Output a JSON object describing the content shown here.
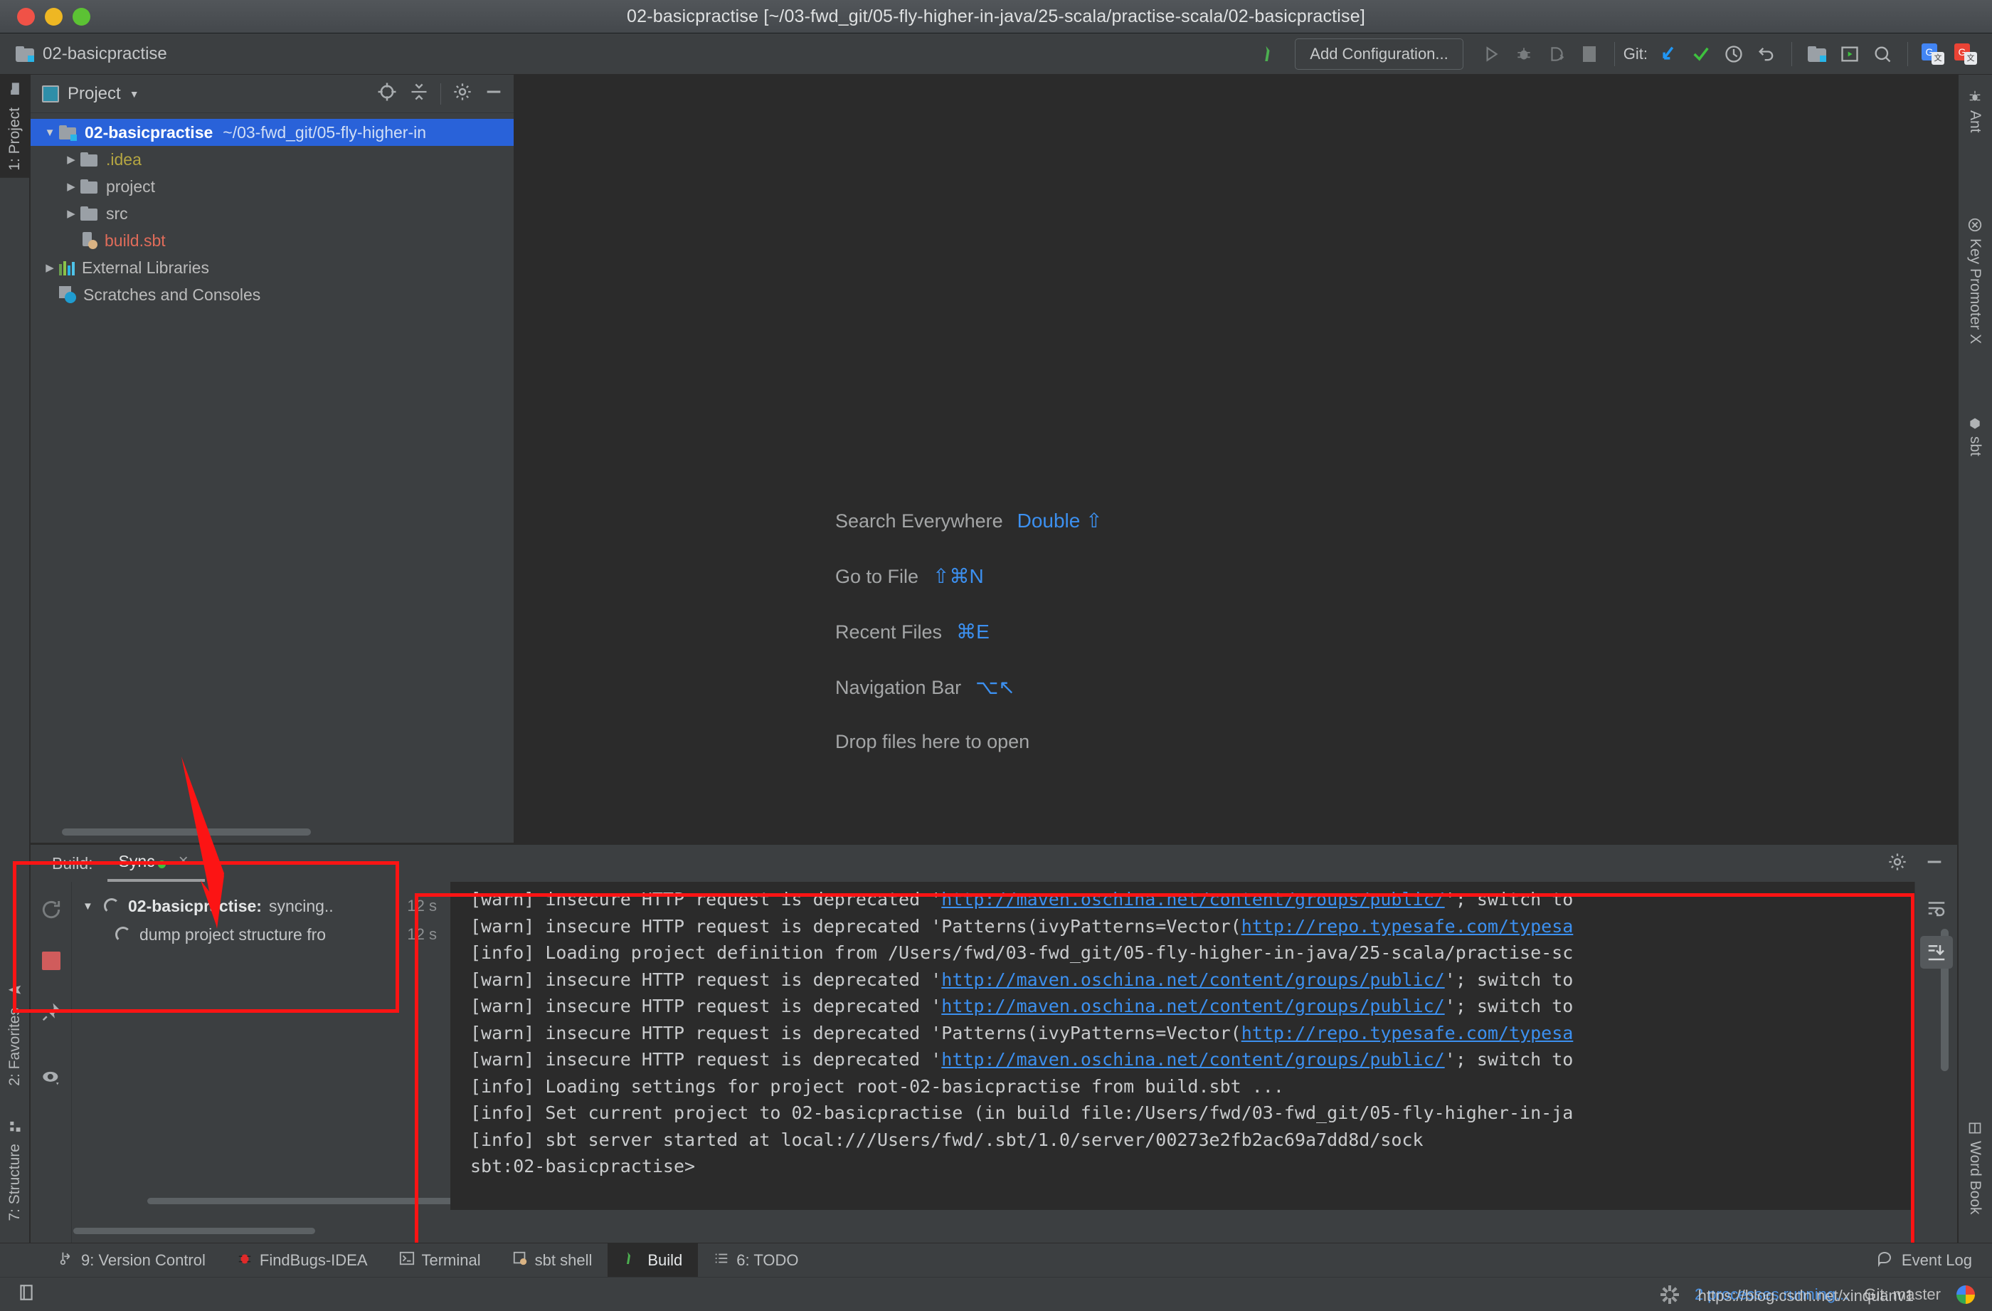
{
  "window": {
    "title": "02-basicpractise [~/03-fwd_git/05-fly-higher-in-java/25-scala/practise-scala/02-basicpractise]",
    "traffic": {
      "close": "close-button",
      "minimize": "minimize-button",
      "zoom": "zoom-button"
    }
  },
  "toolbar": {
    "project_name": "02-basicpractise",
    "add_configuration": "Add Configuration...",
    "git_label": "Git:",
    "icons": [
      "build-hammer-icon",
      "run-icon",
      "debug-icon",
      "coverage-icon",
      "stop-icon",
      "update-project-icon",
      "commit-icon",
      "history-icon",
      "rollback-icon",
      "project-structure-icon",
      "select-target-icon",
      "search-icon",
      "google-translate-icon",
      "translate-icon"
    ]
  },
  "left_strip": {
    "tabs": [
      {
        "label": "1: Project",
        "selected": true
      },
      {
        "label": "2: Favorites",
        "selected": false
      },
      {
        "label": "7: Structure",
        "selected": false
      }
    ]
  },
  "right_strip": {
    "tabs": [
      {
        "label": "Ant"
      },
      {
        "label": "Key Promoter X"
      },
      {
        "label": "sbt"
      },
      {
        "label": "Word Book"
      }
    ]
  },
  "project_panel": {
    "title": "Project",
    "tree": [
      {
        "indent": 0,
        "arrow": "open",
        "icon": "project-folder-icon",
        "name": "02-basicpractise",
        "bold": true,
        "path": "~/03-fwd_git/05-fly-higher-in",
        "selected": true
      },
      {
        "indent": 1,
        "arrow": "closed",
        "icon": "folder-icon",
        "name": ".idea",
        "color": "yellow"
      },
      {
        "indent": 1,
        "arrow": "closed",
        "icon": "folder-icon",
        "name": "project"
      },
      {
        "indent": 1,
        "arrow": "closed",
        "icon": "folder-icon",
        "name": "src"
      },
      {
        "indent": 1,
        "arrow": "none",
        "icon": "sbt-file-icon",
        "name": "build.sbt",
        "color": "red"
      },
      {
        "indent": 0,
        "arrow": "closed",
        "icon": "libraries-icon",
        "name": "External Libraries"
      },
      {
        "indent": 0,
        "arrow": "none",
        "icon": "scratches-icon",
        "name": "Scratches and Consoles"
      }
    ]
  },
  "editor": {
    "tips": [
      {
        "action": "Search Everywhere",
        "shortcut": "Double ⇧"
      },
      {
        "action": "Go to File",
        "shortcut": "⇧⌘N"
      },
      {
        "action": "Recent Files",
        "shortcut": "⌘E"
      },
      {
        "action": "Navigation Bar",
        "shortcut": "⌥↖"
      },
      {
        "action": "Drop files here to open",
        "shortcut": ""
      }
    ]
  },
  "build_panel": {
    "label": "Build:",
    "tab": "Sync",
    "close": "×",
    "side_icons": [
      "rerun-icon",
      "stop-icon",
      "pin-icon",
      "toggle-view-icon"
    ],
    "header_icons": [
      "settings-gear-icon",
      "hide-icon"
    ],
    "console_icons": [
      "soft-wrap-icon",
      "scroll-to-end-icon"
    ],
    "tree": [
      {
        "indent": 0,
        "arrow": "open",
        "bold": "02-basicpractise:",
        "rest": "syncing..",
        "time": "12 s"
      },
      {
        "indent": 1,
        "arrow": "none",
        "bold": "",
        "rest": "dump project structure fro",
        "time": "12 s"
      }
    ],
    "console_lines": [
      [
        {
          "t": "[warn] insecure HTTP request is deprecated '"
        },
        {
          "t": "http://maven.oschina.net/content/groups/public/",
          "link": true
        },
        {
          "t": "'; switch to"
        }
      ],
      [
        {
          "t": "[warn] insecure HTTP request is deprecated 'Patterns(ivyPatterns=Vector("
        },
        {
          "t": "http://repo.typesafe.com/typesa",
          "link": true
        }
      ],
      [
        {
          "t": "[info] Loading project definition from /Users/fwd/03-fwd_git/05-fly-higher-in-java/25-scala/practise-sc"
        }
      ],
      [
        {
          "t": "[warn] insecure HTTP request is deprecated '"
        },
        {
          "t": "http://maven.oschina.net/content/groups/public/",
          "link": true
        },
        {
          "t": "'; switch to"
        }
      ],
      [
        {
          "t": "[warn] insecure HTTP request is deprecated '"
        },
        {
          "t": "http://maven.oschina.net/content/groups/public/",
          "link": true
        },
        {
          "t": "'; switch to"
        }
      ],
      [
        {
          "t": "[warn] insecure HTTP request is deprecated 'Patterns(ivyPatterns=Vector("
        },
        {
          "t": "http://repo.typesafe.com/typesa",
          "link": true
        }
      ],
      [
        {
          "t": "[warn] insecure HTTP request is deprecated '"
        },
        {
          "t": "http://maven.oschina.net/content/groups/public/",
          "link": true
        },
        {
          "t": "'; switch to"
        }
      ],
      [
        {
          "t": "[info] Loading settings for project root-02-basicpractise from build.sbt ..."
        }
      ],
      [
        {
          "t": "[info] Set current project to 02-basicpractise (in build file:/Users/fwd/03-fwd_git/05-fly-higher-in-ja"
        }
      ],
      [
        {
          "t": "[info] sbt server started at local:///Users/fwd/.sbt/1.0/server/00273e2fb2ac69a7dd8d/sock"
        }
      ],
      [
        {
          "t": "sbt:02-basicpractise>"
        }
      ]
    ]
  },
  "bottom_tabs": [
    {
      "label": "9: Version Control",
      "icon": "version-control-icon",
      "selected": false,
      "mnemonic": "9"
    },
    {
      "label": "FindBugs-IDEA",
      "icon": "findbugs-icon",
      "selected": false
    },
    {
      "label": "Terminal",
      "icon": "terminal-icon",
      "selected": false
    },
    {
      "label": "sbt shell",
      "icon": "sbt-shell-icon",
      "selected": false
    },
    {
      "label": "Build",
      "icon": "build-hammer-icon",
      "selected": true
    },
    {
      "label": "6: TODO",
      "icon": "todo-icon",
      "selected": false,
      "mnemonic": "6"
    }
  ],
  "event_log": {
    "label": "Event Log",
    "icon": "event-log-icon"
  },
  "status_bar": {
    "processes": "2 processes running...",
    "git_branch": "Git: master",
    "watermark": "https://blog.csdn.net/xinquanv1"
  },
  "colors": {
    "accent_blue": "#2962d9",
    "link_blue": "#3c90f0",
    "annotation_red": "#fc1414",
    "panel_bg": "#3c3f41",
    "editor_bg": "#2b2b2b"
  }
}
